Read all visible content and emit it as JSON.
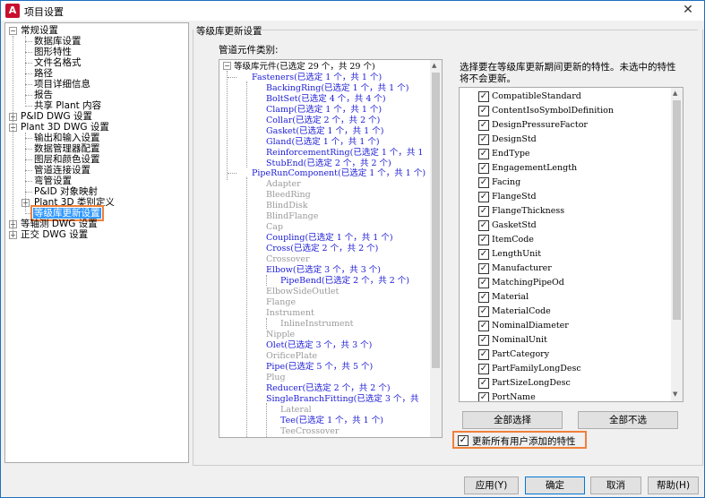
{
  "window": {
    "title": "项目设置",
    "close": "✕",
    "app_icon": "A"
  },
  "nav": {
    "items": [
      {
        "label": "常规设置"
      },
      {
        "label": "数据库设置"
      },
      {
        "label": "图形特性"
      },
      {
        "label": "文件名格式"
      },
      {
        "label": "路径"
      },
      {
        "label": "项目详细信息"
      },
      {
        "label": "报告"
      },
      {
        "label": "共享 Plant 内容"
      },
      {
        "label": "P&ID DWG 设置"
      },
      {
        "label": "Plant 3D DWG 设置"
      },
      {
        "label": "输出和输入设置"
      },
      {
        "label": "数据管理器配置"
      },
      {
        "label": "图层和颜色设置"
      },
      {
        "label": "管道连接设置"
      },
      {
        "label": "弯管设置"
      },
      {
        "label": "P&ID 对象映射"
      },
      {
        "label": "Plant 3D 类别定义"
      },
      {
        "label": "等级库更新设置"
      },
      {
        "label": "等轴测 DWG 设置"
      },
      {
        "label": "正交 DWG 设置"
      }
    ]
  },
  "main": {
    "section_title": "等级库更新设置",
    "pipe_label": "管道元件类别:",
    "tree": [
      {
        "label": "等级库元件(已选定 29 个，共 29 个)"
      },
      {
        "label": "Fasteners(已选定 1 个，共 1 个)"
      },
      {
        "label": "BackingRing(已选定 1 个，共 1 个)"
      },
      {
        "label": "BoltSet(已选定 4 个，共 4 个)"
      },
      {
        "label": "Clamp(已选定 1 个，共 1 个)"
      },
      {
        "label": "Collar(已选定 2 个，共 2 个)"
      },
      {
        "label": "Gasket(已选定 1 个，共 1 个)"
      },
      {
        "label": "Gland(已选定 1 个，共 1 个)"
      },
      {
        "label": "ReinforcementRing(已选定 1 个，共 1"
      },
      {
        "label": "StubEnd(已选定 2 个，共 2 个)"
      },
      {
        "label": "PipeRunComponent(已选定 1 个，共 1 个)"
      },
      {
        "label": "Adapter"
      },
      {
        "label": "BleedRing"
      },
      {
        "label": "BlindDisk"
      },
      {
        "label": "BlindFlange"
      },
      {
        "label": "Cap"
      },
      {
        "label": "Coupling(已选定 1 个，共 1 个)"
      },
      {
        "label": "Cross(已选定 2 个，共 2 个)"
      },
      {
        "label": "Crossover"
      },
      {
        "label": "Elbow(已选定 3 个，共 3 个)"
      },
      {
        "label": "PipeBend(已选定 2 个，共 2 个)"
      },
      {
        "label": "ElbowSideOutlet"
      },
      {
        "label": "Flange"
      },
      {
        "label": "Instrument"
      },
      {
        "label": "InlineInstrument"
      },
      {
        "label": "Nipple"
      },
      {
        "label": "Olet(已选定 3 个，共 3 个)"
      },
      {
        "label": "OrificePlate"
      },
      {
        "label": "Pipe(已选定 5 个，共 5 个)"
      },
      {
        "label": "Plug"
      },
      {
        "label": "Reducer(已选定 2 个，共 2 个)"
      },
      {
        "label": "SingleBranchFitting(已选定 3 个，共"
      },
      {
        "label": "Lateral"
      },
      {
        "label": "Tee(已选定 1 个，共 1 个)"
      },
      {
        "label": "TeeCrossover"
      }
    ],
    "description": "选择要在等级库更新期间更新的特性。未选中的特性将不会更新。",
    "properties": [
      {
        "label": "CompatibleStandard",
        "checked": true
      },
      {
        "label": "ContentIsoSymbolDefinition",
        "checked": true
      },
      {
        "label": "DesignPressureFactor",
        "checked": true
      },
      {
        "label": "DesignStd",
        "checked": true
      },
      {
        "label": "EndType",
        "checked": true
      },
      {
        "label": "EngagementLength",
        "checked": true
      },
      {
        "label": "Facing",
        "checked": true
      },
      {
        "label": "FlangeStd",
        "checked": true
      },
      {
        "label": "FlangeThickness",
        "checked": true
      },
      {
        "label": "GasketStd",
        "checked": true
      },
      {
        "label": "ItemCode",
        "checked": true
      },
      {
        "label": "LengthUnit",
        "checked": true
      },
      {
        "label": "Manufacturer",
        "checked": true
      },
      {
        "label": "MatchingPipeOd",
        "checked": true
      },
      {
        "label": "Material",
        "checked": true
      },
      {
        "label": "MaterialCode",
        "checked": true
      },
      {
        "label": "NominalDiameter",
        "checked": true
      },
      {
        "label": "NominalUnit",
        "checked": true
      },
      {
        "label": "PartCategory",
        "checked": true
      },
      {
        "label": "PartFamilyLongDesc",
        "checked": true
      },
      {
        "label": "PartSizeLongDesc",
        "checked": true
      },
      {
        "label": "PortName",
        "checked": true
      }
    ],
    "select_all": "全部选择",
    "deselect_all": "全部不选",
    "update_user_props": "更新所有用户添加的特性",
    "update_user_props_checked": true
  },
  "footer": {
    "apply": "应用(Y)",
    "ok": "确定",
    "cancel": "取消",
    "help": "帮助(H)"
  },
  "colors": {
    "accent_blue": "#1b1bd6",
    "disabled_gray": "#9a9a9a",
    "highlight_orange": "#f0803c",
    "selection": "#3399ff"
  }
}
